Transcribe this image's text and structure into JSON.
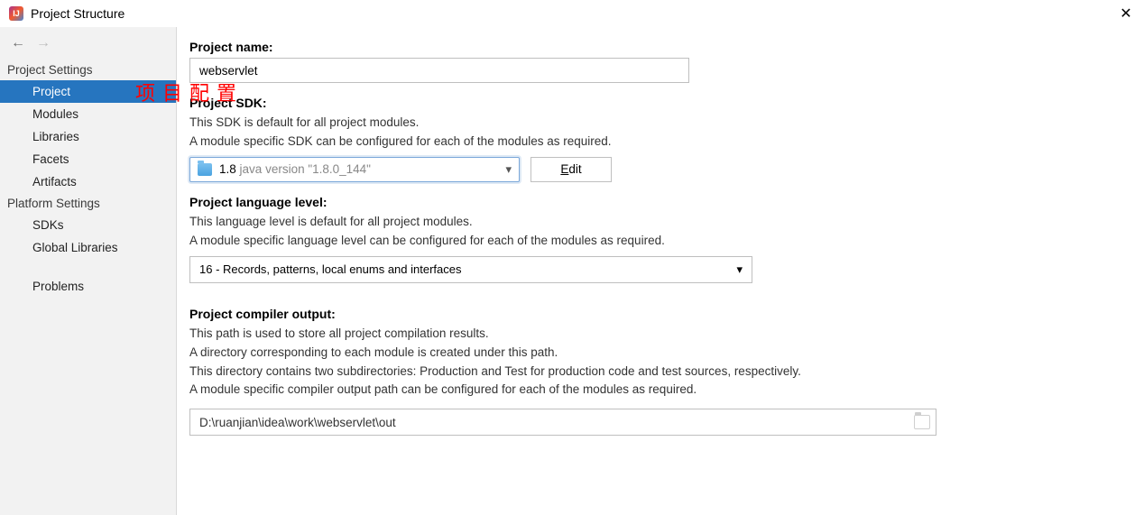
{
  "window": {
    "title": "Project Structure"
  },
  "annotation": "项目配置",
  "sidebar": {
    "group1": {
      "heading": "Project Settings",
      "items": [
        "Project",
        "Modules",
        "Libraries",
        "Facets",
        "Artifacts"
      ],
      "selected_index": 0
    },
    "group2": {
      "heading": "Platform Settings",
      "items": [
        "SDKs",
        "Global Libraries"
      ]
    },
    "group3": {
      "items": [
        "Problems"
      ]
    }
  },
  "project": {
    "name_label": "Project name:",
    "name_value": "webservlet",
    "sdk_label": "Project SDK:",
    "sdk_help1": "This SDK is default for all project modules.",
    "sdk_help2": "A module specific SDK can be configured for each of the modules as required.",
    "sdk_selected_main": "1.8",
    "sdk_selected_detail": "java version \"1.8.0_144\"",
    "edit_label": "Edit",
    "lang_label": "Project language level:",
    "lang_help1": "This language level is default for all project modules.",
    "lang_help2": "A module specific language level can be configured for each of the modules as required.",
    "lang_selected": "16 - Records, patterns, local enums and interfaces",
    "output_label": "Project compiler output:",
    "output_help1": "This path is used to store all project compilation results.",
    "output_help2": "A directory corresponding to each module is created under this path.",
    "output_help3": "This directory contains two subdirectories: Production and Test for production code and test sources, respectively.",
    "output_help4": "A module specific compiler output path can be configured for each of the modules as required.",
    "output_value": "D:\\ruanjian\\idea\\work\\webservlet\\out"
  }
}
